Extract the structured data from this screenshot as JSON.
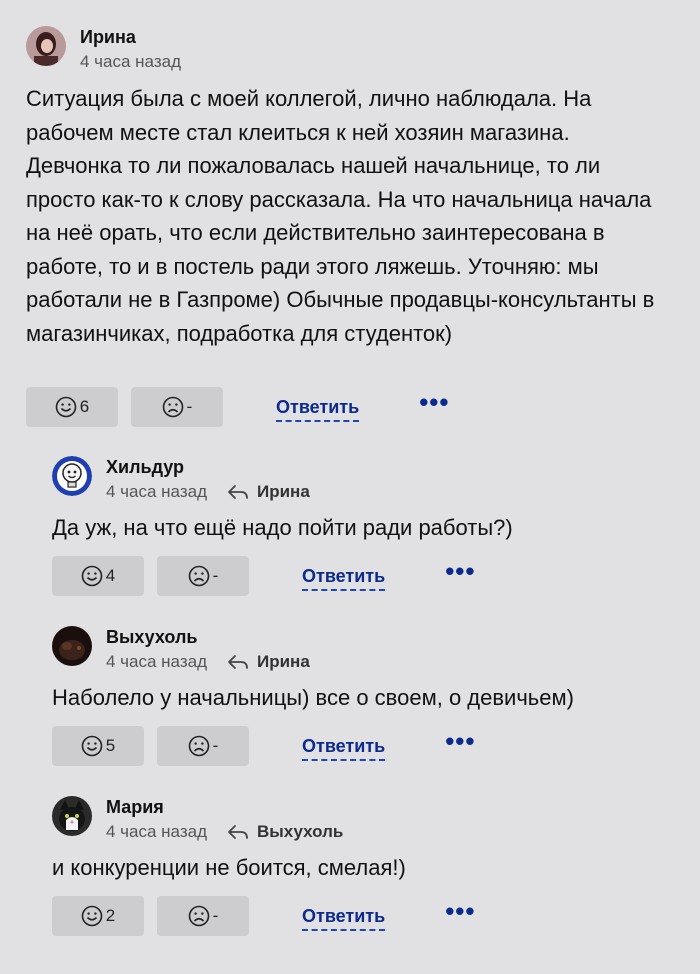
{
  "comments": [
    {
      "author": "Ирина",
      "time": "4 часа назад",
      "reply_to": "",
      "text": "Ситуация была с моей коллегой, лично наблюдала. На рабочем месте стал клеиться к ней хозяин магазина. Девчонка то ли пожаловалась нашей начальнице, то ли просто как-то к слову рассказала. На что начальница начала на неё орать, что если действительно заинтересована в работе, то и в постель ради этого ляжешь. Уточняю: мы работали не в Газпроме) Обычные продавцы-консультанты в магазинчиках, подработка для студенток)",
      "likes": "6",
      "dislikes": "-",
      "reply_label": "Ответить"
    },
    {
      "author": "Хильдур",
      "time": "4 часа назад",
      "reply_to": "Ирина",
      "text": "Да уж, на что ещё надо пойти ради работы?)",
      "likes": "4",
      "dislikes": "-",
      "reply_label": "Ответить"
    },
    {
      "author": "Выхухоль",
      "time": "4 часа назад",
      "reply_to": "Ирина",
      "text": "Наболело у начальницы) все о своем, о девичьем)",
      "likes": "5",
      "dislikes": "-",
      "reply_label": "Ответить"
    },
    {
      "author": "Мария",
      "time": "4 часа назад",
      "reply_to": "Выхухоль",
      "text": "и конкуренции не боится, смелая!)",
      "likes": "2",
      "dislikes": "-",
      "reply_label": "Ответить"
    }
  ],
  "more_label": "•••",
  "icons": {
    "like": "smile-icon",
    "dislike": "frown-icon",
    "reply_arrow": "reply-arrow-icon"
  },
  "colors": {
    "background": "#e1e1e4",
    "button": "#cdcdd0",
    "link": "#0b2a8c"
  }
}
